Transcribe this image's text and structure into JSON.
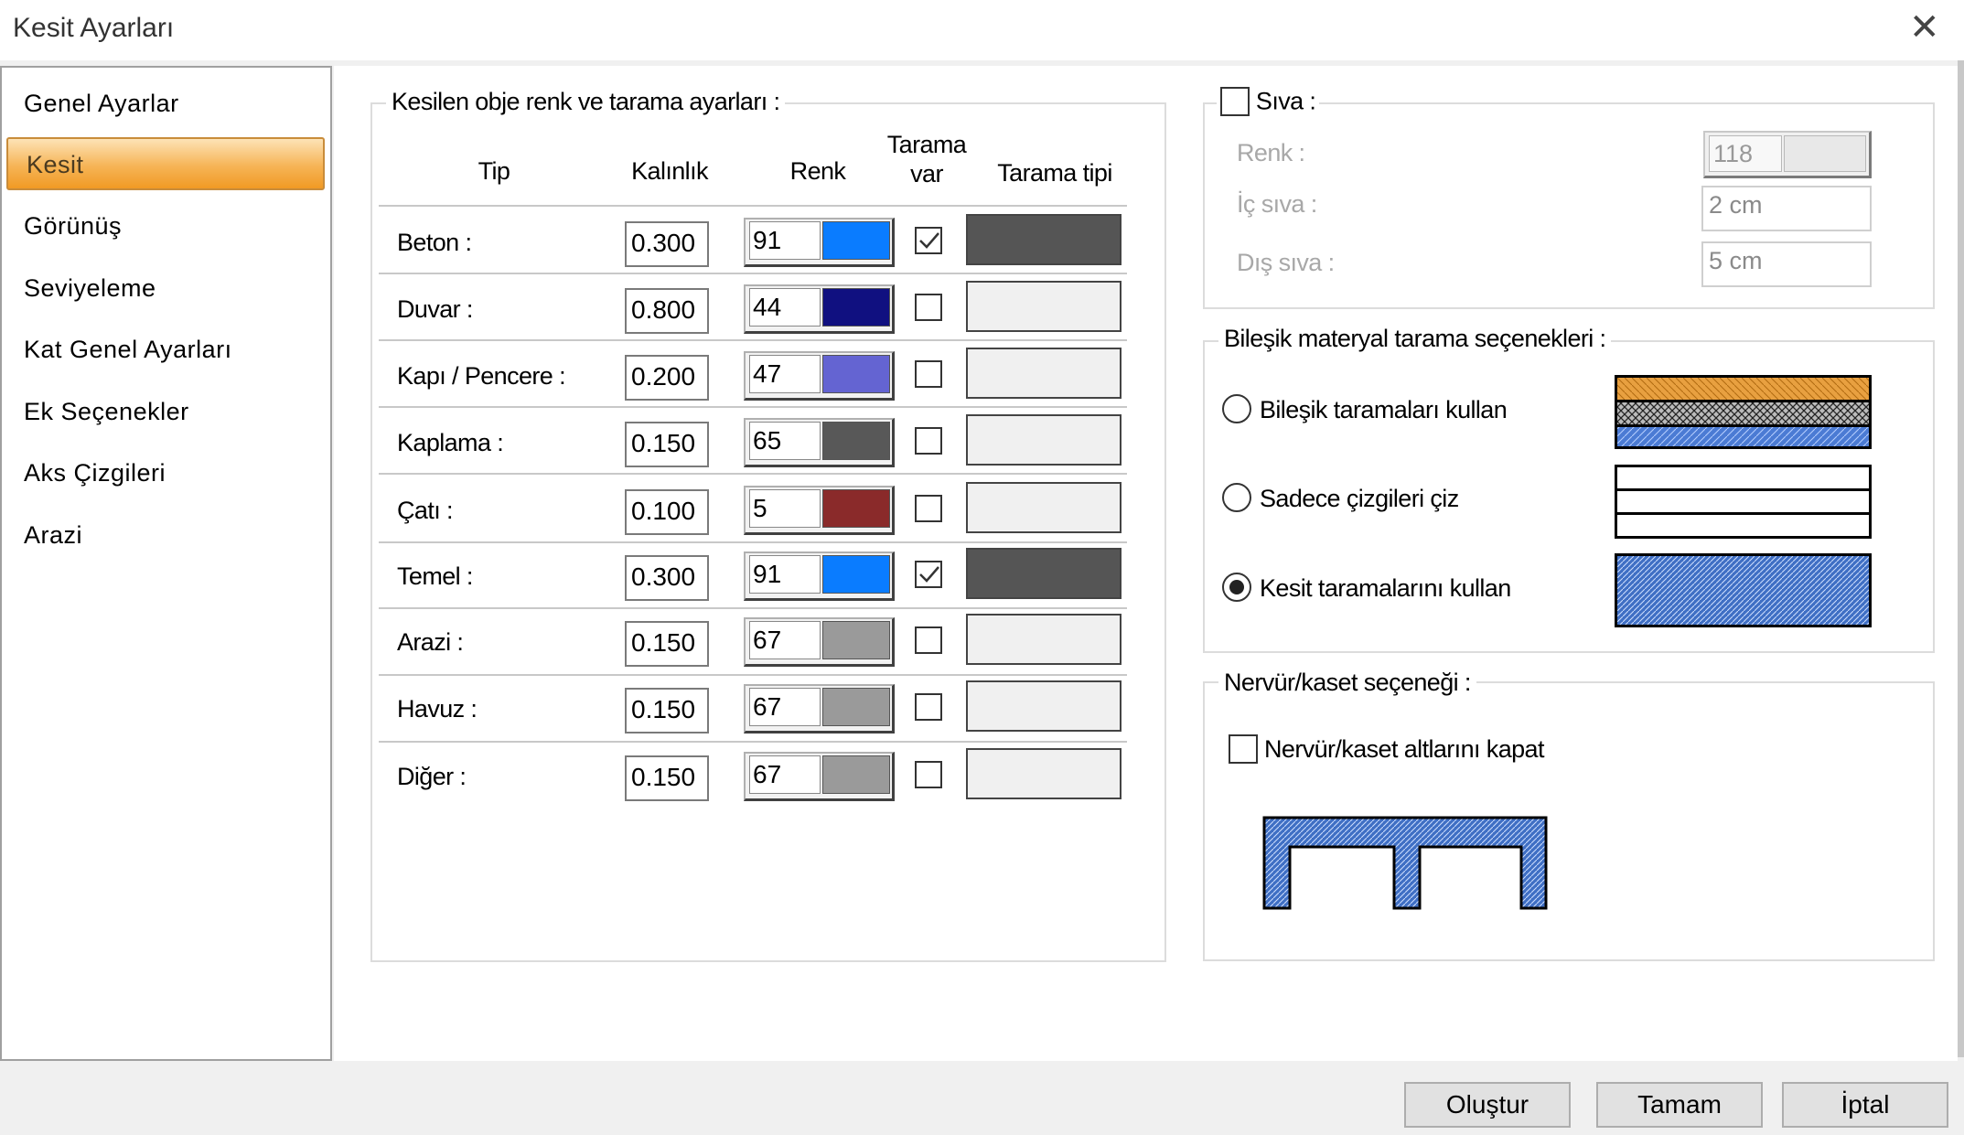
{
  "window": {
    "title": "Kesit Ayarları",
    "close_glyph": "✕"
  },
  "nav": {
    "items": [
      {
        "label": "Genel Ayarlar",
        "selected": false
      },
      {
        "label": "Kesit",
        "selected": true
      },
      {
        "label": "Görünüş",
        "selected": false
      },
      {
        "label": "Seviyeleme",
        "selected": false
      },
      {
        "label": "Kat Genel Ayarları",
        "selected": false
      },
      {
        "label": "Ek Seçenekler",
        "selected": false
      },
      {
        "label": "Aks Çizgileri",
        "selected": false
      },
      {
        "label": "Arazi",
        "selected": false
      }
    ]
  },
  "objects": {
    "group_title": "Kesilen obje renk ve tarama ayarları :",
    "headers": {
      "tip": "Tip",
      "kalinlik": "Kalınlık",
      "renk": "Renk",
      "tarama_var_1": "Tarama",
      "tarama_var_2": "var",
      "tarama_tipi": "Tarama tipi"
    },
    "rows": [
      {
        "label": "Beton :",
        "thickness": "0.300",
        "color_index": "91",
        "color": "#0a7cff",
        "hatch": true
      },
      {
        "label": "Duvar :",
        "thickness": "0.800",
        "color_index": "44",
        "color": "#101080",
        "hatch": false
      },
      {
        "label": "Kapı / Pencere :",
        "thickness": "0.200",
        "color_index": "47",
        "color": "#6464d2",
        "hatch": false
      },
      {
        "label": "Kaplama :",
        "thickness": "0.150",
        "color_index": "65",
        "color": "#585858",
        "hatch": false
      },
      {
        "label": "Çatı :",
        "thickness": "0.100",
        "color_index": "5",
        "color": "#8a2a2a",
        "hatch": false
      },
      {
        "label": "Temel :",
        "thickness": "0.300",
        "color_index": "91",
        "color": "#0a7cff",
        "hatch": true
      },
      {
        "label": "Arazi :",
        "thickness": "0.150",
        "color_index": "67",
        "color": "#9a9a9a",
        "hatch": false
      },
      {
        "label": "Havuz :",
        "thickness": "0.150",
        "color_index": "67",
        "color": "#9a9a9a",
        "hatch": false
      },
      {
        "label": "Diğer :",
        "thickness": "0.150",
        "color_index": "67",
        "color": "#9a9a9a",
        "hatch": false
      }
    ]
  },
  "siva": {
    "checkbox_label": "Sıva :",
    "checked": false,
    "renk_label": "Renk :",
    "renk_value": "118",
    "ic_label": "İç sıva :",
    "ic_value": "2 cm",
    "dis_label": "Dış sıva :",
    "dis_value": "5 cm"
  },
  "bilesik": {
    "group_title": "Bileşik materyal tarama seçenekleri :",
    "options": [
      {
        "label": "Bileşik taramaları kullan",
        "selected": false
      },
      {
        "label": "Sadece çizgileri çiz",
        "selected": false
      },
      {
        "label": "Kesit taramalarını kullan",
        "selected": true
      }
    ]
  },
  "nervur": {
    "group_title": "Nervür/kaset seçeneği :",
    "checkbox_label": "Nervür/kaset altlarını kapat",
    "checked": false
  },
  "buttons": {
    "olustur": "Oluştur",
    "tamam": "Tamam",
    "iptal": "İptal"
  },
  "icons": {
    "close": "close-icon",
    "check": "checkmark-icon"
  }
}
